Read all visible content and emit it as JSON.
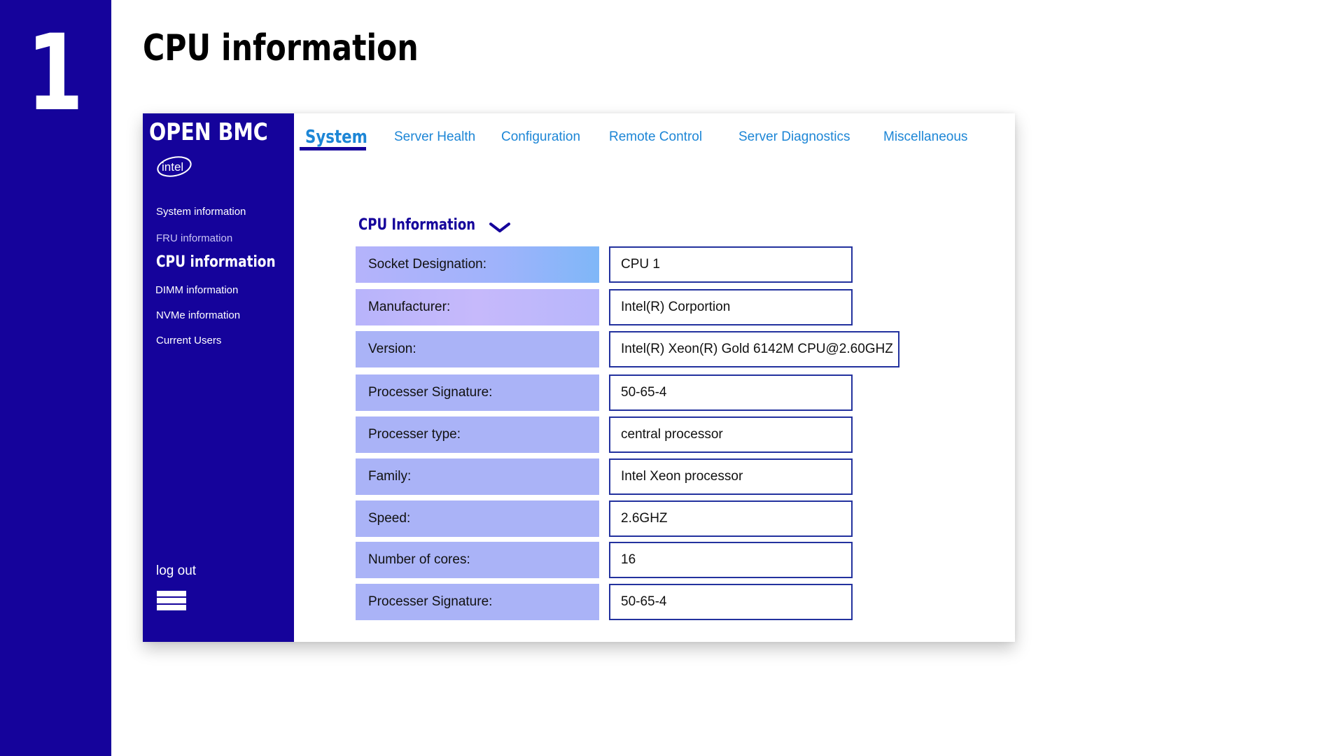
{
  "slide": {
    "number": "1",
    "title": "CPU information"
  },
  "app": {
    "brand": "OPEN BMC",
    "logo_icon": "intel-logo",
    "colors": {
      "sidebar": "#15039b",
      "tab_link": "#1d86d6",
      "label_fill": "#aab3f7",
      "value_border": "#23329e"
    }
  },
  "sidebar": {
    "items": [
      {
        "label": "System information",
        "state": "normal"
      },
      {
        "label": "FRU information",
        "state": "muted"
      },
      {
        "label": "CPU information",
        "state": "active"
      },
      {
        "label": "DIMM information",
        "state": "normal"
      },
      {
        "label": "NVMe information",
        "state": "normal"
      },
      {
        "label": "Current Users",
        "state": "normal"
      }
    ],
    "logout_label": "log out",
    "menu_icon": "hamburger-menu-icon"
  },
  "tabs": [
    {
      "label": "System",
      "active": true
    },
    {
      "label": "Server Health",
      "active": false
    },
    {
      "label": "Configuration",
      "active": false
    },
    {
      "label": "Remote Control",
      "active": false
    },
    {
      "label": "Server Diagnostics",
      "active": false
    },
    {
      "label": "Miscellaneous",
      "active": false
    }
  ],
  "section": {
    "title": "CPU Information",
    "toggle_icon": "chevron-down-icon"
  },
  "fields": [
    {
      "label": "Socket Designation:",
      "value": "CPU 1"
    },
    {
      "label": "Manufacturer:",
      "value": "Intel(R) Corportion"
    },
    {
      "label": "Version:",
      "value": "Intel(R) Xeon(R) Gold 6142M CPU@2.60GHZ"
    },
    {
      "label": "Processer Signature:",
      "value": "50-65-4"
    },
    {
      "label": "Processer type:",
      "value": "central processor"
    },
    {
      "label": "Family:",
      "value": "Intel Xeon processor"
    },
    {
      "label": "Speed:",
      "value": "2.6GHZ"
    },
    {
      "label": "Number of cores:",
      "value": "16"
    },
    {
      "label": "Processer Signature:",
      "value": "50-65-4"
    }
  ]
}
